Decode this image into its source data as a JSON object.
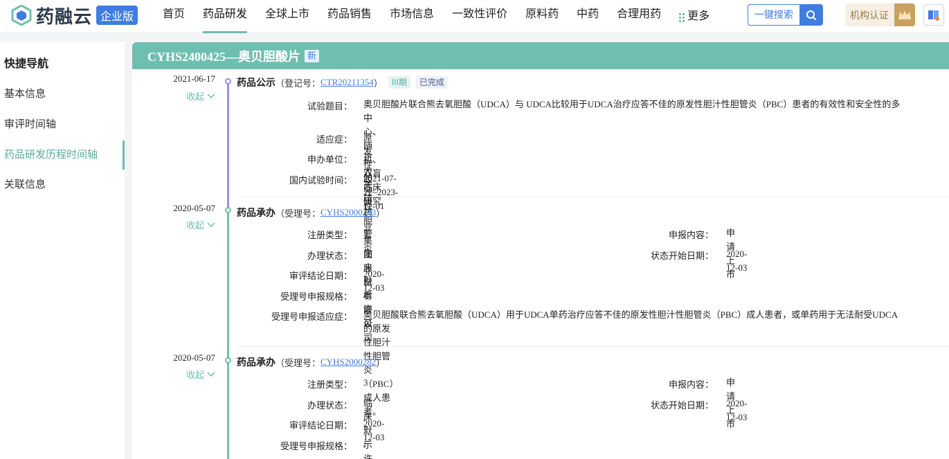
{
  "brand": {
    "name": "药融云",
    "edition": "企业版"
  },
  "nav": {
    "items": [
      "首页",
      "药品研发",
      "全球上市",
      "药品销售",
      "市场信息",
      "一致性评价",
      "原料药",
      "中药",
      "合理用药"
    ],
    "more": "更多",
    "active_index": 1
  },
  "search": {
    "label": "一键搜索"
  },
  "cert": {
    "label": "机构认证"
  },
  "sidebar": {
    "title": "快捷导航",
    "items": [
      "基本信息",
      "审评时间轴",
      "药品研发历程时间轴",
      "关联信息"
    ],
    "active_index": 2
  },
  "header": {
    "title": "CYHS2400425—奥贝胆酸片",
    "badge": "新"
  },
  "timeline": [
    {
      "date": "2021-06-17",
      "toggle": "收起",
      "title": "药品公示",
      "sub_prefix": "（登记号：",
      "sub_link": "CTR20211354",
      "sub_suffix": "）",
      "tags": [
        "III期",
        "已完成"
      ],
      "fields": [
        {
          "k": "试验题目：",
          "v": "奥贝胆酸片联合熊去氧胆酸（UDCA）与 UDCA比较用于UDCA治疗应答不佳的原发性胆汁性胆管炎（PBC）患者的有效性和安全性的多",
          "v2": "中心、随机、双盲临床研究"
        },
        {
          "k": "适应症：",
          "v": "原发性胆汁性胆管炎"
        },
        {
          "k": "申办单位：",
          "v": "正大天晴药业集团股份有限公司"
        },
        {
          "k": "国内试验时间：",
          "v": "2021-07-22~2023-12-01"
        }
      ]
    },
    {
      "date": "2020-05-07",
      "toggle": "收起",
      "title": "药品承办",
      "sub_prefix": "（受理号：",
      "sub_link": "CYHS2000283",
      "sub_suffix": "）",
      "fields": [
        {
          "k": "注册类型：",
          "v": "3",
          "k2": "申报内容：",
          "v2b": "申请上市"
        },
        {
          "k": "办理状态：",
          "v": "临床默示许可",
          "k2": "状态开始日期：",
          "v2b": "2020-12-03"
        },
        {
          "k": "审评结论日期：",
          "v": "2020-12-03"
        },
        {
          "k": "受理号申报规格：",
          "v": "/"
        },
        {
          "k": "受理号申报适应症：",
          "v": "奥贝胆酸联合熊去氧胆酸（UDCA）用于UDCA单药治疗应答不佳的原发性胆汁性胆管炎（PBC）成人患者，或单药用于无法耐受UDCA",
          "v2": "的原发性胆汁性胆管炎（PBC）成人患者。"
        }
      ]
    },
    {
      "date": "2020-05-07",
      "toggle": "收起",
      "title": "药品承办",
      "sub_prefix": "（受理号：",
      "sub_link": "CYHS2000282",
      "sub_suffix": "）",
      "fields": [
        {
          "k": "注册类型：",
          "v": "3",
          "k2": "申报内容：",
          "v2b": "申请上市"
        },
        {
          "k": "办理状态：",
          "v": "临床默示许可",
          "k2": "状态开始日期：",
          "v2b": "2020-12-03"
        },
        {
          "k": "审评结论日期：",
          "v": "2020-12-03"
        },
        {
          "k": "受理号申报规格：",
          "v": "/"
        }
      ]
    }
  ],
  "colors": {
    "accent": "#6fbfb0",
    "link": "#3f7de0",
    "purple": "#9a8ee6"
  }
}
